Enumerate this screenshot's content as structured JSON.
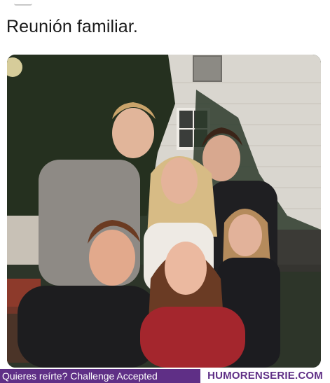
{
  "post": {
    "caption": "Reunión familiar."
  },
  "watermark": {
    "question": "Quieres reírte? Challenge Accepted",
    "site": "HUMORENSERIE.COM",
    "bar_color": "#5f2f86"
  },
  "icons": {
    "top_crop": "avatar-fragment-icon"
  }
}
